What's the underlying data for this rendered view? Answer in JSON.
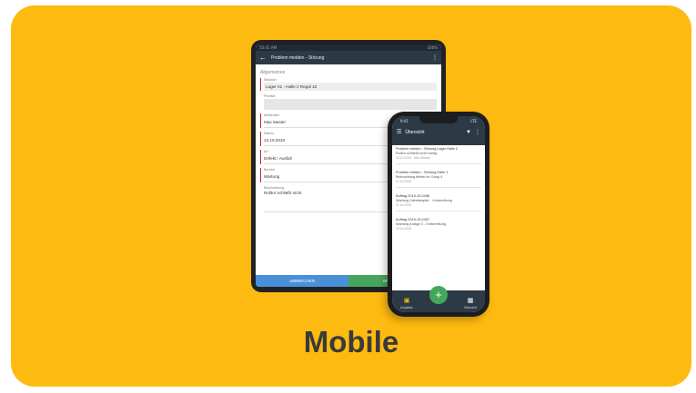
{
  "caption": "Mobile",
  "tablet": {
    "status_left": "10:41 AM",
    "status_right": "100%",
    "toolbar_title": "Problem melden - Störung",
    "section_title": "Allgemeines",
    "fields": [
      {
        "label": "Standort",
        "value": "Lager 01 - Halle 2 Regal 10",
        "kind": "select",
        "required": true
      },
      {
        "label": "Priorität",
        "value": "",
        "kind": "box",
        "required": false
      },
      {
        "label": "Meldender",
        "value": "Max Muster",
        "kind": "text",
        "required": true
      },
      {
        "label": "Datum",
        "value": "13.10.2019",
        "kind": "text",
        "required": true
      },
      {
        "label": "Art",
        "value": "Defekt / Ausfall",
        "kind": "text",
        "required": true
      },
      {
        "label": "Bereich",
        "value": "Wartung",
        "kind": "text",
        "required": true
      },
      {
        "label": "Beschreibung",
        "value": "Rolltor schließt nicht",
        "kind": "grow",
        "required": false
      }
    ],
    "button_cancel": "ABBRECHEN",
    "button_save": "SPEICHERN"
  },
  "phone": {
    "status_left": "9:41",
    "status_right": "LTE",
    "title": "Übersicht",
    "items": [
      {
        "line1": "Problem melden - Störung Lager Halle 2",
        "line2": "Rolltor schließt nicht richtig",
        "line3": "13.10.2019 - Max Muster"
      },
      {
        "line1": "Problem melden - Störung Halle 1",
        "line2": "Beleuchtung defekt im Gang 4",
        "line3": "12.10.2019"
      },
      {
        "line1": "Auftrag 2019-10-0458",
        "line2": "Wartung Gabelstapler - Vorbereitung",
        "line3": "11.10.2019"
      },
      {
        "line1": "Auftrag 2019-10-0457",
        "line2": "Wartung Anlage 3 - Vorbereitung",
        "line3": "10.10.2019"
      }
    ],
    "nav_left": "Aufgaben",
    "nav_right": "Übersicht",
    "fab": "+"
  }
}
